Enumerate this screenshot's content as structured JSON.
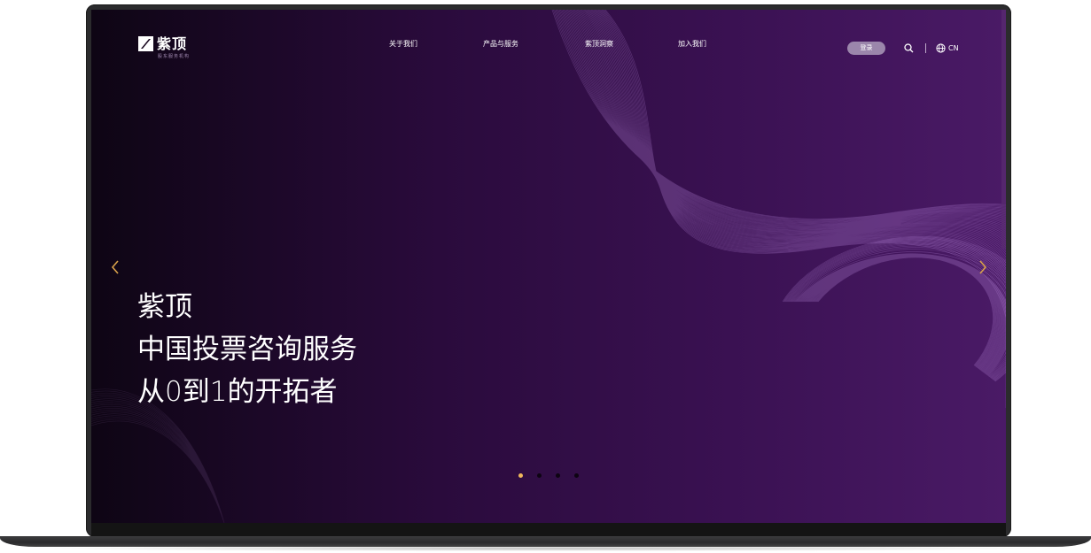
{
  "brand": {
    "name": "紫顶",
    "tagline": "股东服务机构"
  },
  "nav": {
    "items": [
      {
        "label": "关于我们"
      },
      {
        "label": "产品与服务"
      },
      {
        "label": "紫顶洞察"
      },
      {
        "label": "加入我们"
      }
    ],
    "login_label": "登录",
    "language_label": "CN"
  },
  "hero": {
    "lines": [
      "紫顶",
      "中国投票咨询服务",
      "从0到1的开拓者"
    ]
  },
  "carousel": {
    "slide_count": 4,
    "active_index": 0
  },
  "colors": {
    "accent": "#f0b95c",
    "background_dark": "#0e0514",
    "background_purple": "#4a1a66",
    "login_button": "#9b86ab"
  },
  "icons": {
    "search": "search-icon",
    "globe": "globe-icon",
    "prev": "chevron-left-icon",
    "next": "chevron-right-icon"
  }
}
